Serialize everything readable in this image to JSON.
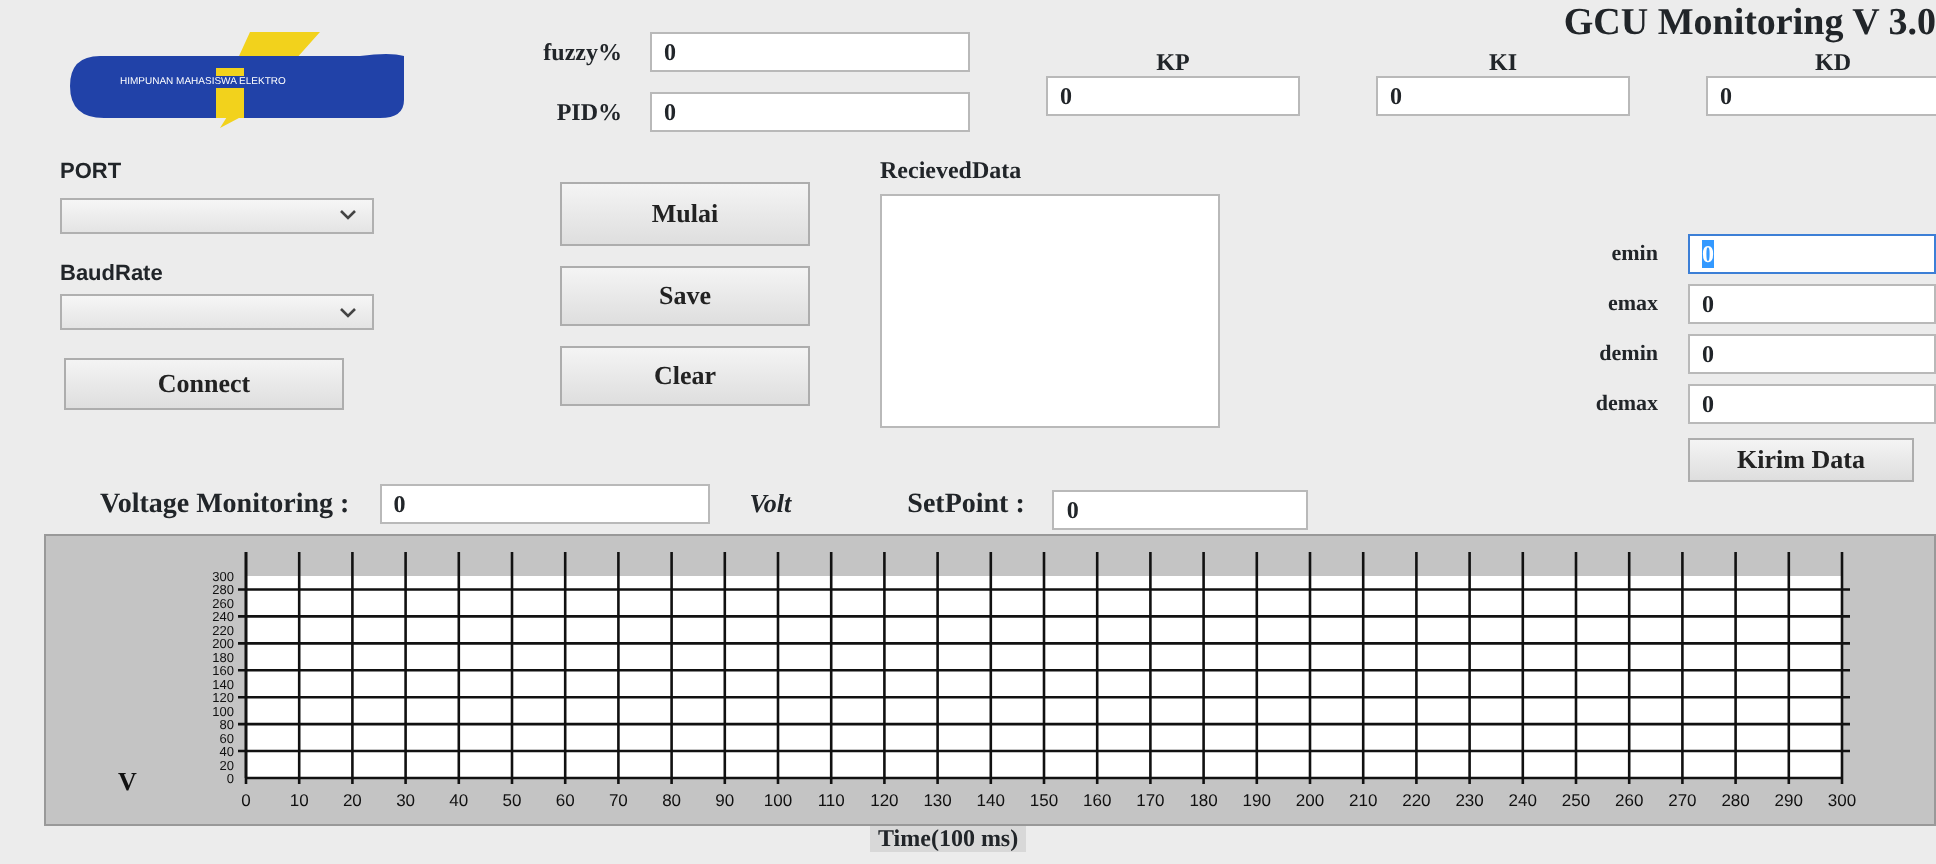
{
  "logo": {
    "text": "HIMPUNAN MAHASISWA ELEKTRO"
  },
  "title": "GCU Monitoring V 3.0",
  "ratio_fields": [
    {
      "label": "fuzzy%",
      "value": "0"
    },
    {
      "label": "PID%",
      "value": "0"
    }
  ],
  "gain_fields": [
    {
      "label": "KP",
      "value": "0"
    },
    {
      "label": "KI",
      "value": "0"
    },
    {
      "label": "KD",
      "value": "0"
    }
  ],
  "connection": {
    "port_label": "PORT",
    "baud_label": "BaudRate",
    "connect_button": "Connect"
  },
  "action_buttons": [
    "Mulai",
    "Save",
    "Clear"
  ],
  "received": {
    "label": "RecievedData"
  },
  "error_fields": [
    {
      "label": "emin",
      "value": "0",
      "focused": true
    },
    {
      "label": "emax",
      "value": "0",
      "focused": false
    },
    {
      "label": "demin",
      "value": "0",
      "focused": false
    },
    {
      "label": "demax",
      "value": "0",
      "focused": false
    }
  ],
  "send_button": "Kirim Data",
  "voltage": {
    "label": "Voltage Monitoring :",
    "value": "0",
    "unit": "Volt"
  },
  "setpoint": {
    "label": "SetPoint :",
    "value": "0"
  },
  "chart": {
    "chart_data": {
      "type": "line",
      "grid": true,
      "xlabel": "Time(100 ms)",
      "ylabel": "V",
      "xlim": [
        0,
        300
      ],
      "ylim": [
        0,
        300
      ],
      "xticks": [
        0,
        10,
        20,
        30,
        40,
        50,
        60,
        70,
        80,
        90,
        100,
        110,
        120,
        130,
        140,
        150,
        160,
        170,
        180,
        190,
        200,
        210,
        220,
        230,
        240,
        250,
        260,
        270,
        280,
        290,
        300
      ],
      "yticks": [
        0,
        20,
        40,
        60,
        80,
        100,
        120,
        140,
        160,
        180,
        200,
        220,
        240,
        260,
        280,
        300
      ]
    }
  }
}
